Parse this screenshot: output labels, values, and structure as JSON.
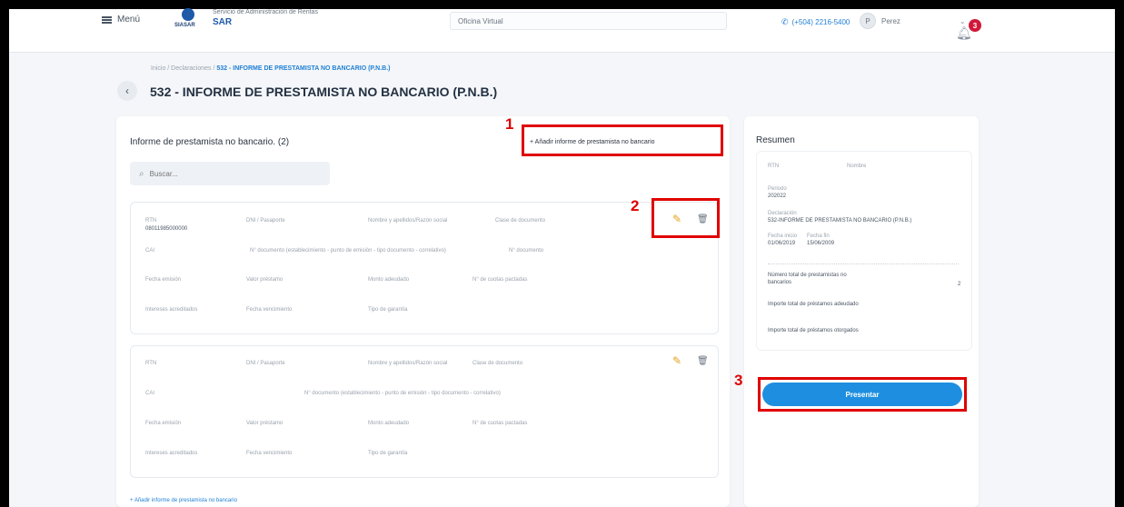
{
  "topbar": {
    "menu_label": "Menú",
    "logo_text": "SIASAR",
    "org_line": "Servicio de Administración de Rentas",
    "org_abbr": "SAR",
    "portal_label": "Oficina Virtual",
    "phone": "(+504) 2216-5400",
    "user_name": "Perez",
    "notifications": "3"
  },
  "header": {
    "breadcrumb_prefix": "Inicio / Declaraciones / ",
    "breadcrumb_current": "532 - INFORME DE PRESTAMISTA NO BANCARIO (P.N.B.)",
    "title": "532 - INFORME DE PRESTAMISTA NO BANCARIO (P.N.B.)"
  },
  "main": {
    "heading": "Informe de prestamista no bancario. (2)",
    "add_button": "+ Añadir informe de prestamista no bancario",
    "search_placeholder": "Buscar...",
    "bottom_link": "+ Añadir informe de prestamista no bancario",
    "record1": {
      "rtn_label": "RTN",
      "rtn_value": "08011985000000",
      "dni_label": "DNI / Pasaporte",
      "name_label": "Nombre y apellidos/Razón social",
      "class_label": "Clase de documento",
      "cai_label": "CAI",
      "doc_label": "N° documento (establecimiento - punto de emisión - tipo documento - correlativo)",
      "ndoc_label": "N° documento",
      "fecha_label": "Fecha emisión",
      "valor_label": "Valor préstamo",
      "monto_label": "Monto adeudado",
      "cuota_label": "N° de cuotas pactadas",
      "interes_label": "Intereses acreditados",
      "venc_label": "Fecha vencimiento",
      "garantia_label": "Tipo de garantía"
    },
    "record2": {
      "rtn_label": "RTN",
      "dni_label": "DNI / Pasaporte",
      "name_label": "Nombre y apellidos/Razón social",
      "class_label": "Clase de documento",
      "cai_label": "CAI",
      "doc_label": "N° documento (establecimiento - punto de emisión - tipo documento - correlativo)",
      "ndoc_label": "N° documento",
      "fecha_label": "Fecha emisión",
      "valor_label": "Valor préstamo",
      "monto_label": "Monto adeudado",
      "cuota_label": "N° de cuotas pactadas",
      "interes_label": "Intereses acreditados",
      "venc_label": "Fecha vencimiento",
      "garantia_label": "Tipo de garantía"
    }
  },
  "summary": {
    "title": "Resumen",
    "rtn_label": "RTN",
    "rtn_value": "Nombre",
    "periodo_label": "Periodo",
    "periodo_value": "202022",
    "declaracion_label": "Declaración",
    "declaracion_value": "532-INFORME DE PRESTAMISTA NO BANCARIO (P.N.B.)",
    "fecha_inicio_label": "Fecha inicio",
    "fecha_inicio_value": "01/06/2019",
    "fecha_fin_label": "Fecha fin",
    "fecha_fin_value": "15/06/2009",
    "row1_label": "Número total de prestamistas no bancarios",
    "row1_value": "2",
    "row2_label": "Importe total de préstamos adeudado",
    "row3_label": "Importe total de préstamos otorgados",
    "present_button": "Presentar"
  },
  "annotations": {
    "n1": "1",
    "n2": "2",
    "n3": "3",
    "color": "#e00000"
  }
}
